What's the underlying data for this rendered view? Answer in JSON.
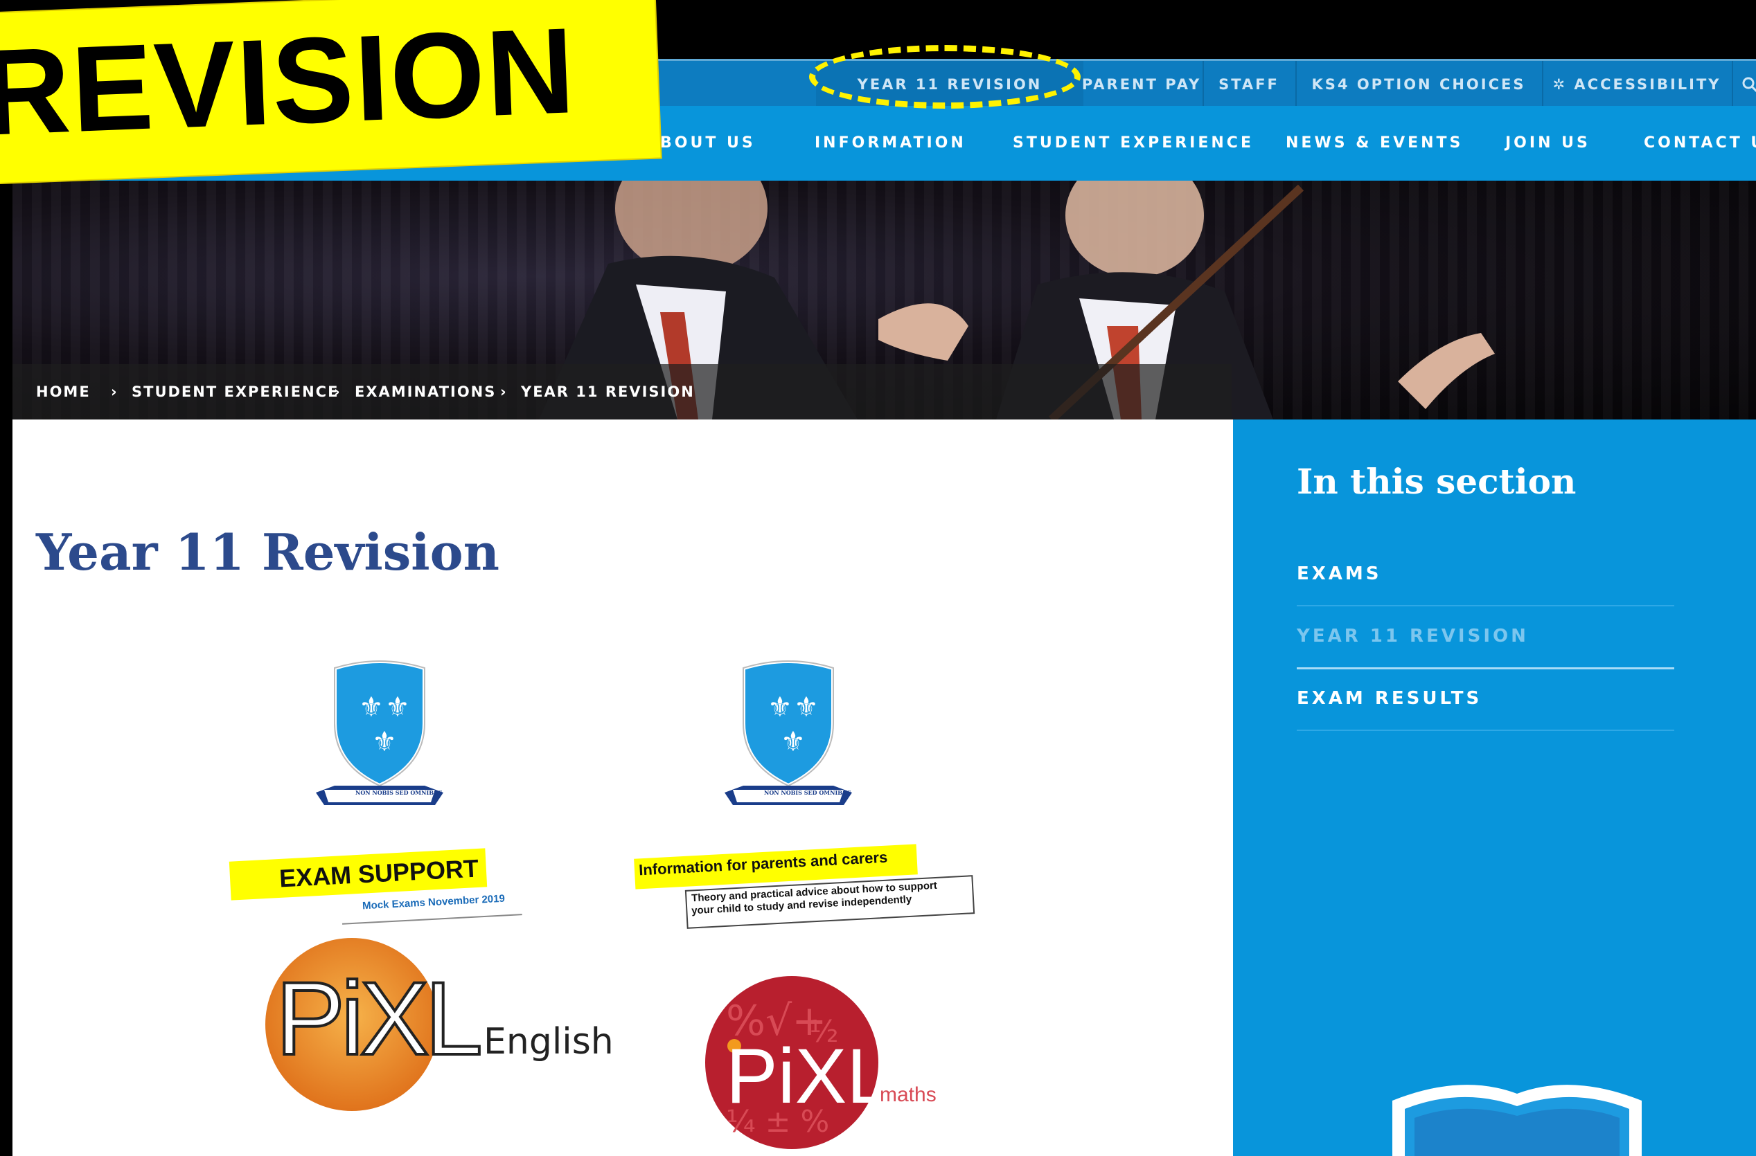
{
  "banner": {
    "text": "REVISION"
  },
  "topbar": {
    "items": [
      "YEAR 11 REVISION",
      "PARENT PAY",
      "STAFF",
      "KS4 OPTION CHOICES",
      "ACCESSIBILITY"
    ]
  },
  "mainnav": {
    "items": [
      "BOUT US",
      "INFORMATION",
      "STUDENT EXPERIENCE",
      "NEWS & EVENTS",
      "JOIN US",
      "CONTACT US"
    ]
  },
  "breadcrumb": {
    "items": [
      "HOME",
      "STUDENT EXPERIENCE",
      "EXAMINATIONS",
      "YEAR 11 REVISION"
    ],
    "separator": "›"
  },
  "page": {
    "title": "Year 11 Revision"
  },
  "tiles": {
    "exam_support": {
      "title": "EXAM SUPPORT",
      "subtitle": "Mock Exams November 2019",
      "motto": "NON NOBIS SED OMNIBUS"
    },
    "parents": {
      "title": "Information for parents and carers",
      "line1": "Theory and practical advice about how to support",
      "line2": "your child to study and revise independently",
      "motto": "NON NOBIS SED OMNIBUS"
    },
    "pixl_english": {
      "brand": "PiXL",
      "subject": "English"
    },
    "pixl_maths": {
      "brand": "PiXL",
      "subject": "maths"
    }
  },
  "sidebar": {
    "heading": "In this section",
    "links": [
      "EXAMS",
      "YEAR 11 REVISION",
      "EXAM RESULTS"
    ]
  },
  "colors": {
    "nav_blue": "#0895db",
    "topbar_blue": "#0d7cc0",
    "title_blue": "#2c4a8c",
    "highlight_yellow": "#ffff00"
  }
}
